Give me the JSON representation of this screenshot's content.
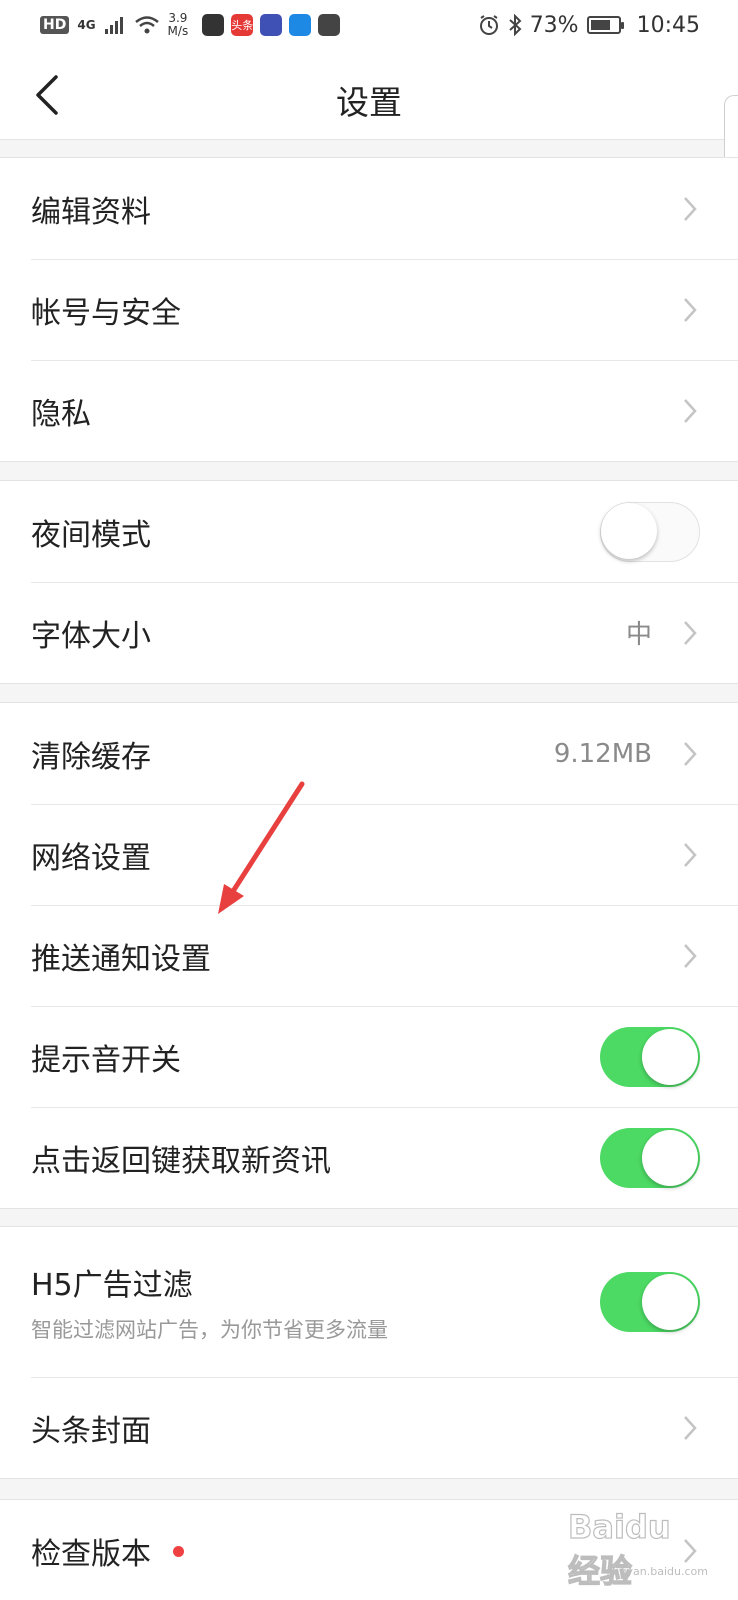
{
  "status_bar": {
    "hd": "HD",
    "network": "4G",
    "speed_value": "3.9",
    "speed_unit": "M/s",
    "app_icons": [
      {
        "name": "qq-icon",
        "color": "#333333",
        "label": ""
      },
      {
        "name": "toutiao-icon",
        "color": "#e53935",
        "label": "头条"
      },
      {
        "name": "baidu-netdisk-icon",
        "color": "#3f51b5",
        "label": ""
      },
      {
        "name": "browser-icon",
        "color": "#1e88e5",
        "label": ""
      },
      {
        "name": "wechat-icon",
        "color": "#444444",
        "label": ""
      }
    ],
    "battery_percent": "73%",
    "battery_level": 0.73,
    "time": "10:45"
  },
  "nav": {
    "title": "设置"
  },
  "sections": {
    "account": {
      "rows": [
        {
          "label": "编辑资料"
        },
        {
          "label": "帐号与安全"
        },
        {
          "label": "隐私"
        }
      ]
    },
    "display": {
      "night_mode": {
        "label": "夜间模式",
        "on": false
      },
      "font_size": {
        "label": "字体大小",
        "value": "中"
      }
    },
    "general": {
      "clear_cache": {
        "label": "清除缓存",
        "value": "9.12MB"
      },
      "network": {
        "label": "网络设置"
      },
      "push": {
        "label": "推送通知设置"
      },
      "sound": {
        "label": "提示音开关",
        "on": true
      },
      "back_refresh": {
        "label": "点击返回键获取新资讯",
        "on": true
      }
    },
    "content": {
      "h5_filter": {
        "label": "H5广告过滤",
        "sub": "智能过滤网站广告，为你节省更多流量",
        "on": true
      },
      "cover": {
        "label": "头条封面"
      }
    },
    "about": {
      "check_version": {
        "label": "检查版本",
        "has_update_dot": true
      }
    }
  },
  "colors": {
    "toggle_on": "#4cd964",
    "annotation_arrow": "#e8403f",
    "update_dot": "#f04142"
  },
  "watermark": {
    "brand": "Baidu 经验",
    "url": "jingyan.baidu.com"
  }
}
